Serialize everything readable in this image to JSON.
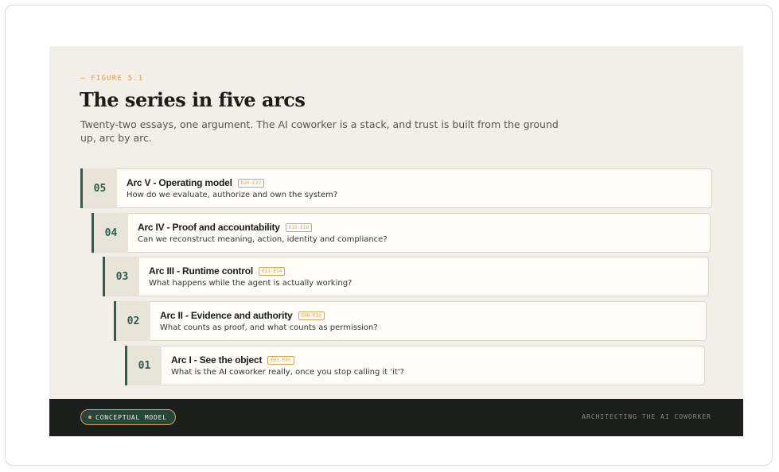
{
  "figure": {
    "eyebrow": "— FIGURE 5.1",
    "title": "The series in five arcs",
    "subtitle": "Twenty-two essays, one argument. The AI coworker is a stack, and trust is built from the ground up, arc by arc."
  },
  "arcs": [
    {
      "num": "05",
      "name": "Arc V - Operating model",
      "range": "E20-E22",
      "question": "How do we evaluate, authorize and own the system?"
    },
    {
      "num": "04",
      "name": "Arc IV - Proof and accountability",
      "range": "E15-E19",
      "question": "Can we reconstruct meaning, action, identity and compliance?"
    },
    {
      "num": "03",
      "name": "Arc III - Runtime control",
      "range": "E11-E14",
      "question": "What happens while the agent is actually working?"
    },
    {
      "num": "02",
      "name": "Arc II - Evidence and authority",
      "range": "E06-E10",
      "question": "What counts as proof, and what counts as permission?"
    },
    {
      "num": "01",
      "name": "Arc I - See the object",
      "range": "E01-E05",
      "question": "What is the AI coworker really, once you stop calling it 'it'?"
    }
  ],
  "footer": {
    "pill_label": "CONCEPTUAL MODEL",
    "brand": "ARCHITECTING THE AI COWORKER"
  },
  "colors": {
    "accent": "#e0a24a",
    "green": "#2d5e4e",
    "panel": "#f2efe8",
    "footer_bg": "#1c1e1b"
  }
}
